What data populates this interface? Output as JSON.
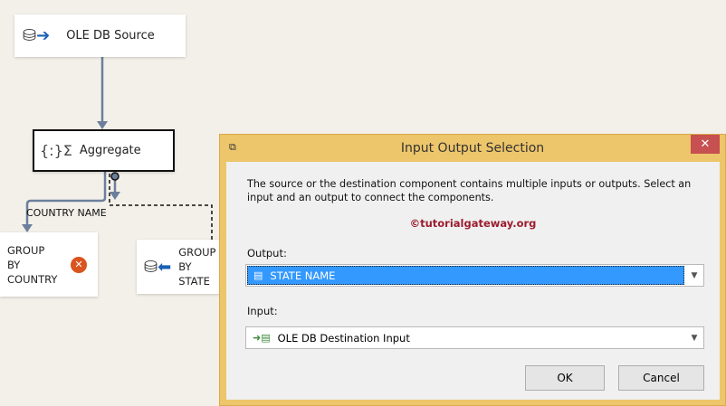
{
  "canvas": {
    "source_node": {
      "label": "OLE DB Source",
      "icon": "database-source-icon"
    },
    "aggregate_node": {
      "label": "Aggregate",
      "icon": "aggregate-icon"
    },
    "country_node": {
      "label_lines": [
        "GROUP",
        "BY",
        "COUNTRY"
      ],
      "status": "error-icon"
    },
    "state_node": {
      "label_lines": [
        "GROUP",
        "BY",
        "STATE"
      ],
      "icon": "database-destination-icon"
    },
    "path_label": "COUNTRY NAME"
  },
  "dialog": {
    "title": "Input Output Selection",
    "close_label": "✕",
    "description": "The source or the destination component contains multiple inputs or outputs. Select an input and an output to connect the components.",
    "watermark": "©tutorialgateway.org",
    "output_label": "Output:",
    "output_value": "STATE NAME",
    "input_label": "Input:",
    "input_value": "OLE DB Destination Input",
    "ok_label": "OK",
    "cancel_label": "Cancel"
  },
  "colors": {
    "dialog_border": "#edc56a",
    "close": "#c75050",
    "selection": "#3399ff",
    "watermark": "#9b1c2e"
  }
}
